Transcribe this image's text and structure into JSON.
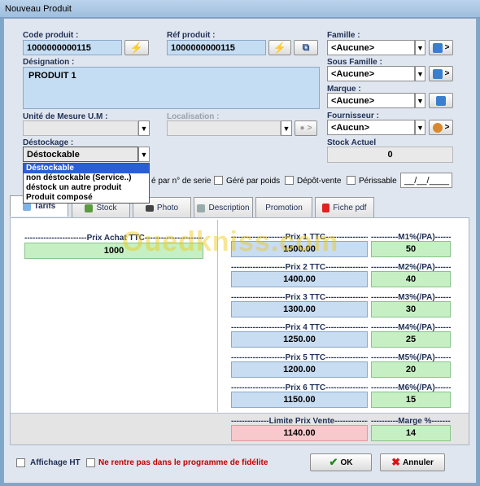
{
  "window": {
    "title": "Nouveau Produit"
  },
  "form": {
    "code_label": "Code produit :",
    "code_value": "1000000000115",
    "ref_label": "Réf produit :",
    "ref_value": "1000000000115",
    "designation_label": "Désignation :",
    "designation_value": "PRODUIT 1",
    "unite_label": "Unité de Mesure U.M :",
    "unite_value": "",
    "localisation_label": "Localisation :",
    "localisation_value": "",
    "destockage_label": "Déstockage :",
    "destockage_value": "Déstockable",
    "destockage_options": [
      "Déstockable",
      "non déstockable (Service..)",
      "déstock un autre produit",
      "Produit composé"
    ],
    "famille_label": "Famille :",
    "famille_value": "<Aucune>",
    "sous_famille_label": "Sous Famille :",
    "sous_famille_value": "<Aucune>",
    "marque_label": "Marque :",
    "marque_value": "<Aucune>",
    "fournisseur_label": "Fournisseur :",
    "fournisseur_value": "<Aucun>",
    "stock_label": "Stock Actuel",
    "stock_value": "0",
    "arrow_label": ">",
    "dropdown_glyph": "▼"
  },
  "options": {
    "serie_label": "é par n° de serie",
    "poids_label": "Géré par poids",
    "depot_label": "Dépôt-vente",
    "perissable_label": "Périssable",
    "date_value": "__/__/____"
  },
  "tabs": [
    "Tarifs",
    "Stock",
    "Photo",
    "Description",
    "Promotion",
    "Fiche pdf"
  ],
  "tarifs": {
    "achat_label": "-----------------------Prix Achat TTC------------------------",
    "achat_value": "1000",
    "prices": [
      {
        "label": "--------------------Prix 1 TTC--------------------",
        "value": "1500.00",
        "m_label": "----------M1%(/PA)----------",
        "m_value": "50"
      },
      {
        "label": "--------------------Prix 2 TTC--------------------",
        "value": "1400.00",
        "m_label": "----------M2%(/PA)----------",
        "m_value": "40"
      },
      {
        "label": "--------------------Prix 3 TTC--------------------",
        "value": "1300.00",
        "m_label": "----------M3%(/PA)----------",
        "m_value": "30"
      },
      {
        "label": "--------------------Prix 4 TTC--------------------",
        "value": "1250.00",
        "m_label": "----------M4%(/PA)----------",
        "m_value": "25"
      },
      {
        "label": "--------------------Prix 5 TTC--------------------",
        "value": "1200.00",
        "m_label": "----------M5%(/PA)----------",
        "m_value": "20"
      },
      {
        "label": "--------------------Prix 6 TTC--------------------",
        "value": "1150.00",
        "m_label": "----------M6%(/PA)----------",
        "m_value": "15"
      }
    ],
    "limite_label": "--------------Limite Prix Vente--------------",
    "limite_value": "1140.00",
    "marge_label": "----------Marge %----------",
    "marge_value": "14"
  },
  "watermark": "Ouedkniss.com",
  "footer": {
    "affichage_label": "Affichage HT",
    "fidelite_label": "Ne rentre pas dans le programme de fidélite",
    "ok_label": "OK",
    "annuler_label": "Annuler"
  },
  "colors": {
    "accent": "#c5ddf3",
    "green": "#c6f0c3",
    "pink": "#f7c8cc",
    "red": "#c20000"
  }
}
